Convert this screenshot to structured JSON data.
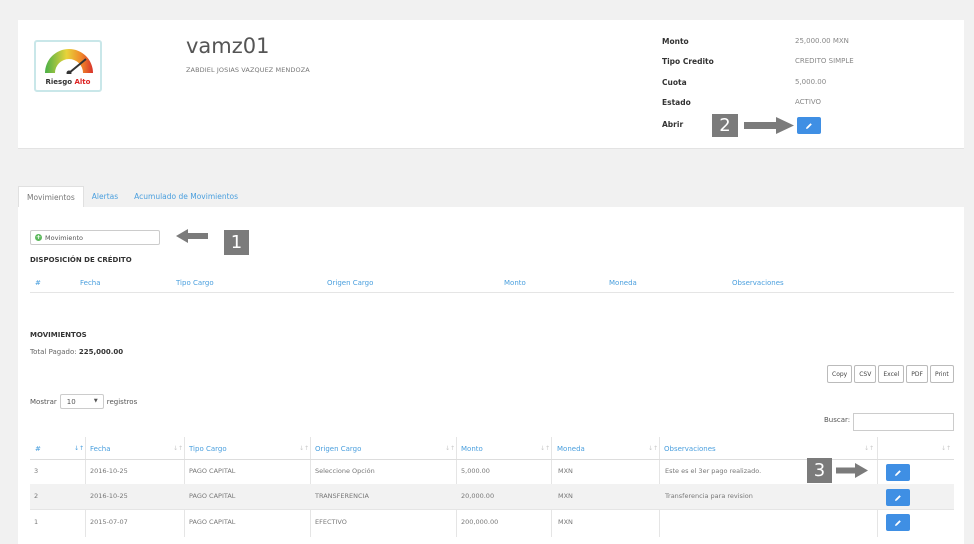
{
  "profile": {
    "logo_text_1": "Riesgo",
    "logo_text_2": "Alto",
    "username": "vamz01",
    "fullname": "ZABDIEL JOSIAS VAZQUEZ MENDOZA"
  },
  "credit_info": [
    {
      "label": "Monto",
      "value": "25,000.00 MXN"
    },
    {
      "label": "Tipo Credito",
      "value": "CREDITO SIMPLE"
    },
    {
      "label": "Cuota",
      "value": "5,000.00"
    },
    {
      "label": "Estado",
      "value": "ACTIVO"
    },
    {
      "label": "Abrir",
      "value": ""
    }
  ],
  "annotations": {
    "one": "1",
    "two": "2",
    "three": "3"
  },
  "tabs": [
    "Movimientos",
    "Alertas",
    "Acumulado de Movimientos"
  ],
  "movimiento_button": "Movimiento",
  "disposicion": {
    "title": "DISPOSICIÓN DE CRÉDITO",
    "headers": [
      "#",
      "Fecha",
      "Tipo Cargo",
      "Origen Cargo",
      "Monto",
      "Moneda",
      "Observaciones"
    ]
  },
  "movimientos": {
    "title": "MOVIMIENTOS",
    "total_label": "Total Pagado:",
    "total_value": "225,000.00",
    "export_buttons": [
      "Copy",
      "CSV",
      "Excel",
      "PDF",
      "Print"
    ],
    "mostrar_label": "Mostrar",
    "page_size": "10",
    "registros_label": "registros",
    "buscar_label": "Buscar:",
    "headers": [
      "#",
      "Fecha",
      "Tipo Cargo",
      "Origen Cargo",
      "Monto",
      "Moneda",
      "Observaciones"
    ],
    "rows": [
      [
        "3",
        "2016-10-25",
        "PAGO CAPITAL",
        "Seleccione Opción",
        "5,000.00",
        "MXN",
        "Este es el 3er pago realizado."
      ],
      [
        "2",
        "2016-10-25",
        "PAGO CAPITAL",
        "TRANSFERENCIA",
        "20,000.00",
        "MXN",
        "Transferencia para revision"
      ],
      [
        "1",
        "2015-07-07",
        "PAGO CAPITAL",
        "EFECTIVO",
        "200,000.00",
        "MXN",
        ""
      ]
    ]
  },
  "colors": {
    "accent": "#3f8fe4",
    "link": "#4a9fde",
    "annotation": "#7b7b7b",
    "success": "#5cb85c"
  }
}
